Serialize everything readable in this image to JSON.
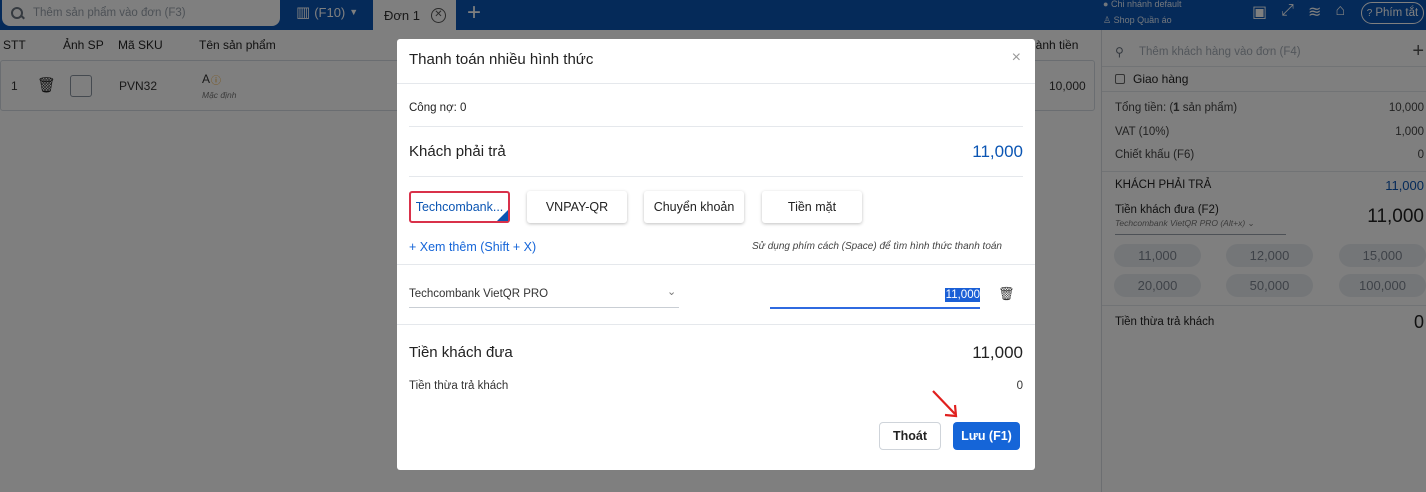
{
  "topbar": {
    "search_placeholder": "Thêm sản phẩm vào đơn (F3)",
    "scan_label": "(F10)",
    "tab_label": "Đơn 1",
    "branch": "Chi nhánh default",
    "shop": "Shop Quần áo",
    "hotkey_label": "Phím tắt"
  },
  "table": {
    "headers": {
      "stt": "STT",
      "image": "Ảnh SP",
      "sku": "Mã SKU",
      "name": "Tên sản phẩm",
      "total": "hành tiền"
    },
    "rows": [
      {
        "stt": "1",
        "sku": "PVN32",
        "name": "A",
        "variant": "Mặc định",
        "total": "10,000"
      }
    ]
  },
  "right_panel": {
    "customer_placeholder": "Thêm khách hàng vào đơn (F4)",
    "delivery_label": "Giao hàng",
    "total_label_pre": "Tổng tiền: (",
    "total_count": "1",
    "total_label_post": " sản phẩm)",
    "total_value": "10,000",
    "vat_label": "VAT (10%)",
    "vat_value": "1,000",
    "discount_label": "Chiết khấu (F6)",
    "discount_value": "0",
    "pay_label": "KHÁCH PHẢI TRẢ",
    "pay_value": "11,000",
    "given_label": "Tiền khách đưa (F2)",
    "given_method": "Techcombank VietQR PRO (Alt+x)",
    "given_value": "11,000",
    "suggestions": [
      "11,000",
      "12,000",
      "15,000",
      "20,000",
      "50,000",
      "100,000"
    ],
    "change_label": "Tiền thừa trả khách",
    "change_value": "0"
  },
  "modal": {
    "title": "Thanh toán nhiều hình thức",
    "debt": "Công nợ: 0",
    "pay_label": "Khách phải trả",
    "pay_value": "11,000",
    "methods": [
      "Techcombank...",
      "VNPAY-QR",
      "Chuyển khoản",
      "Tiền mặt"
    ],
    "more_link": "+ Xem thêm (Shift + X)",
    "hint": "Sử dụng phím cách (Space) để tìm hình thức thanh toán",
    "selected_method": "Techcombank VietQR PRO",
    "amount": "11,000",
    "given_label": "Tiền khách đưa",
    "given_value": "11,000",
    "change_label": "Tiền thừa trả khách",
    "change_value": "0",
    "exit_label": "Thoát",
    "save_label": "Lưu (F1)"
  },
  "colors": {
    "brand": "#0b55b3",
    "primary_button": "#1565d8",
    "active_border": "#d9314a",
    "annotation_arrow": "#e0201e"
  }
}
